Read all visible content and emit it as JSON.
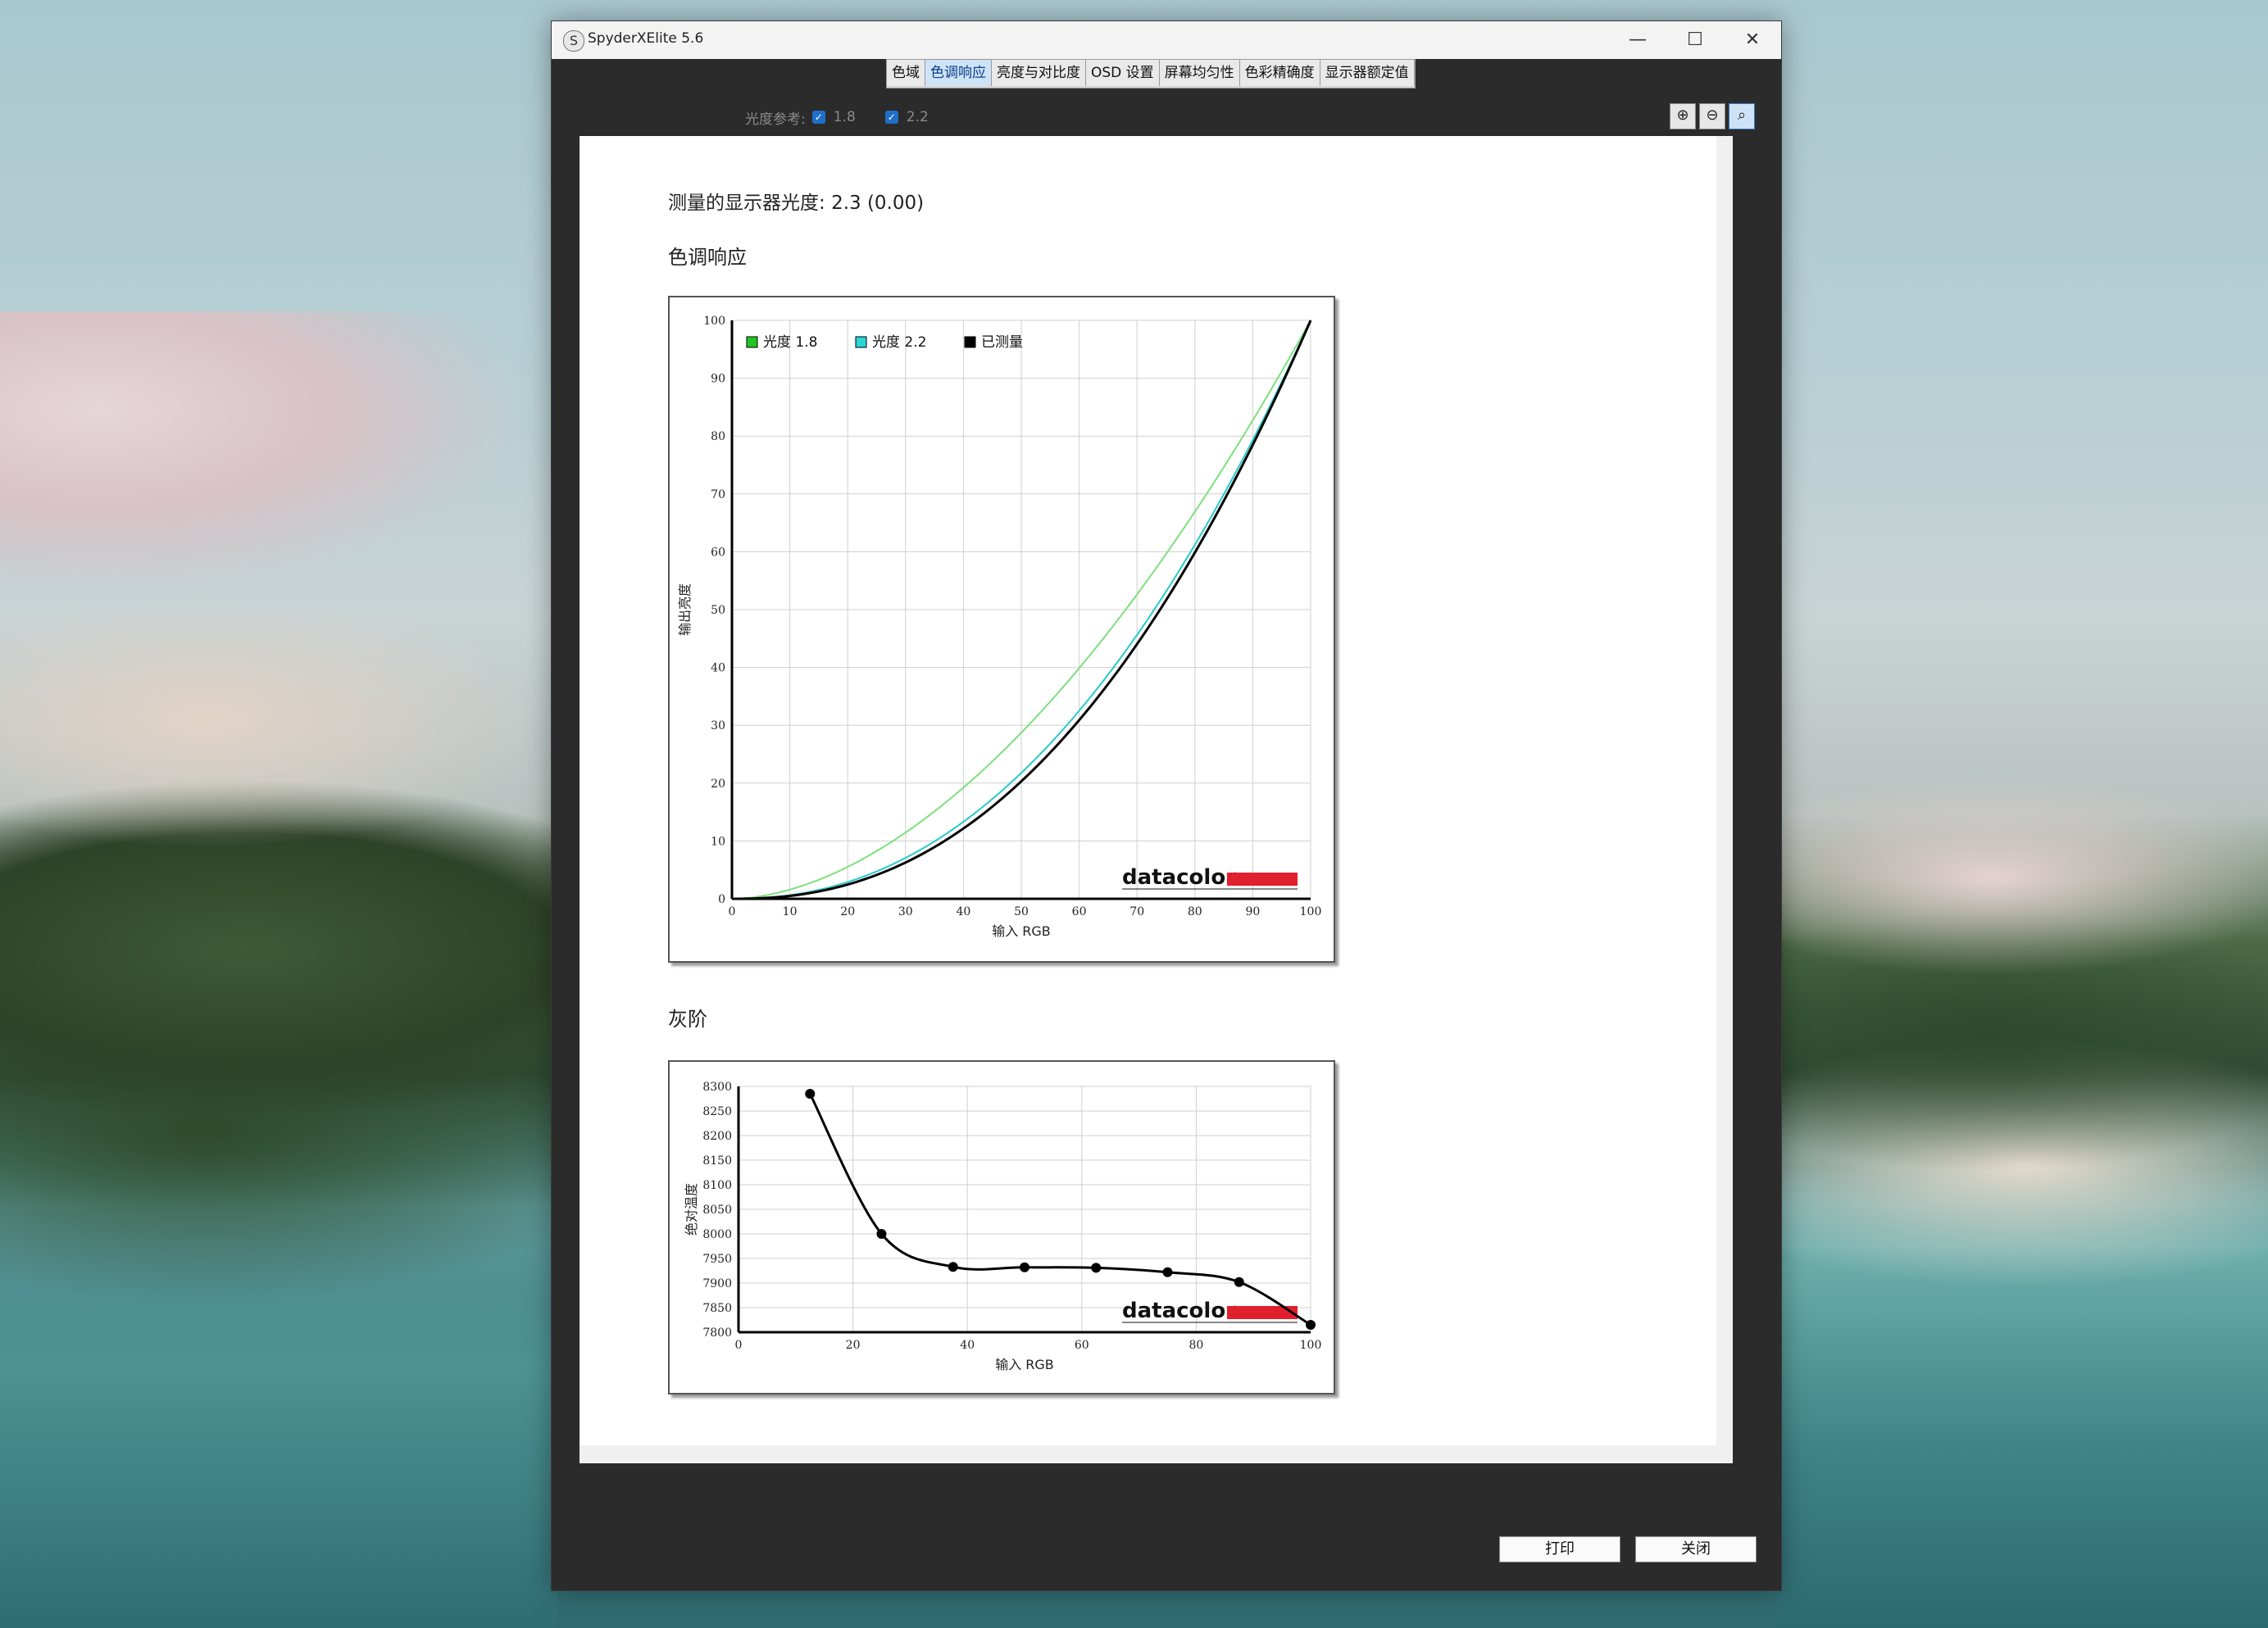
{
  "window": {
    "title": "SpyderXElite 5.6",
    "icon": "spyder-s-icon",
    "app_icon_glyph": "S",
    "controls": {
      "minimize": "—",
      "maximize": "☐",
      "close": "✕"
    }
  },
  "tabs": [
    "色域",
    "色调响应",
    "亮度与对比度",
    "OSD 设置",
    "屏幕均匀性",
    "色彩精确度",
    "显示器额定值"
  ],
  "active_tab": "色调响应",
  "gamma_reference": {
    "label": "光度参考:",
    "options": [
      {
        "label": "1.8",
        "checked": true
      },
      {
        "label": "2.2",
        "checked": true
      }
    ]
  },
  "zoom_tools": [
    {
      "name": "zoom-in-icon",
      "glyph": "⊕"
    },
    {
      "name": "zoom-out-icon",
      "glyph": "⊖"
    },
    {
      "name": "zoom-fit-icon",
      "glyph": "🔍"
    }
  ],
  "report": {
    "measured_label": "测量的显示器光度:",
    "measured_value": "2.3 (0.00)",
    "tone_section": "色调响应",
    "gray_section": "灰阶"
  },
  "chart_data": [
    {
      "type": "line",
      "xlabel": "输入 RGB",
      "ylabel": "输出亮度",
      "xlim": [
        0,
        100
      ],
      "ylim": [
        0,
        100
      ],
      "xticks": [
        0,
        10,
        20,
        30,
        40,
        50,
        60,
        70,
        80,
        90,
        100
      ],
      "yticks": [
        0,
        10,
        20,
        30,
        40,
        50,
        60,
        70,
        80,
        90,
        100
      ],
      "grid": true,
      "legend_position": "top-left",
      "series": [
        {
          "name": "光度 1.8",
          "color": "#7de07d",
          "gamma": 1.8,
          "x": [
            0,
            10,
            20,
            30,
            40,
            50,
            60,
            70,
            80,
            90,
            100
          ],
          "y": [
            0,
            1.6,
            5.5,
            11.5,
            19.2,
            28.7,
            39.9,
            52.6,
            66.9,
            82.7,
            100
          ]
        },
        {
          "name": "光度 2.2",
          "color": "#29c9c9",
          "gamma": 2.2,
          "x": [
            0,
            10,
            20,
            30,
            40,
            50,
            60,
            70,
            80,
            90,
            100
          ],
          "y": [
            0,
            0.6,
            2.9,
            7.1,
            13.3,
            21.8,
            32.5,
            45.6,
            61.2,
            79.3,
            100
          ]
        },
        {
          "name": "已测量",
          "color": "#000000",
          "gamma": 2.3,
          "x": [
            0,
            10,
            20,
            30,
            40,
            50,
            60,
            70,
            80,
            90,
            100
          ],
          "y": [
            0,
            0.5,
            2.5,
            6.3,
            12.2,
            20.3,
            30.9,
            44.0,
            59.8,
            78.5,
            100
          ]
        }
      ],
      "watermark": "datacolor"
    },
    {
      "type": "line",
      "xlabel": "输入 RGB",
      "ylabel": "绝对温度",
      "xlim": [
        0,
        100
      ],
      "ylim": [
        7800,
        8300
      ],
      "xticks": [
        0,
        20,
        40,
        60,
        80,
        100
      ],
      "yticks": [
        7800,
        7850,
        7900,
        7950,
        8000,
        8050,
        8100,
        8150,
        8200,
        8250,
        8300
      ],
      "grid": true,
      "series": [
        {
          "name": "",
          "color": "#000000",
          "x": [
            12.5,
            25,
            37.5,
            50,
            62.5,
            75,
            87.5,
            100
          ],
          "y": [
            8285,
            8000,
            7933,
            7932,
            7931,
            7922,
            7902,
            7815
          ]
        }
      ],
      "watermark": "datacolor"
    }
  ],
  "buttons": {
    "print": "打印",
    "close": "关闭"
  }
}
